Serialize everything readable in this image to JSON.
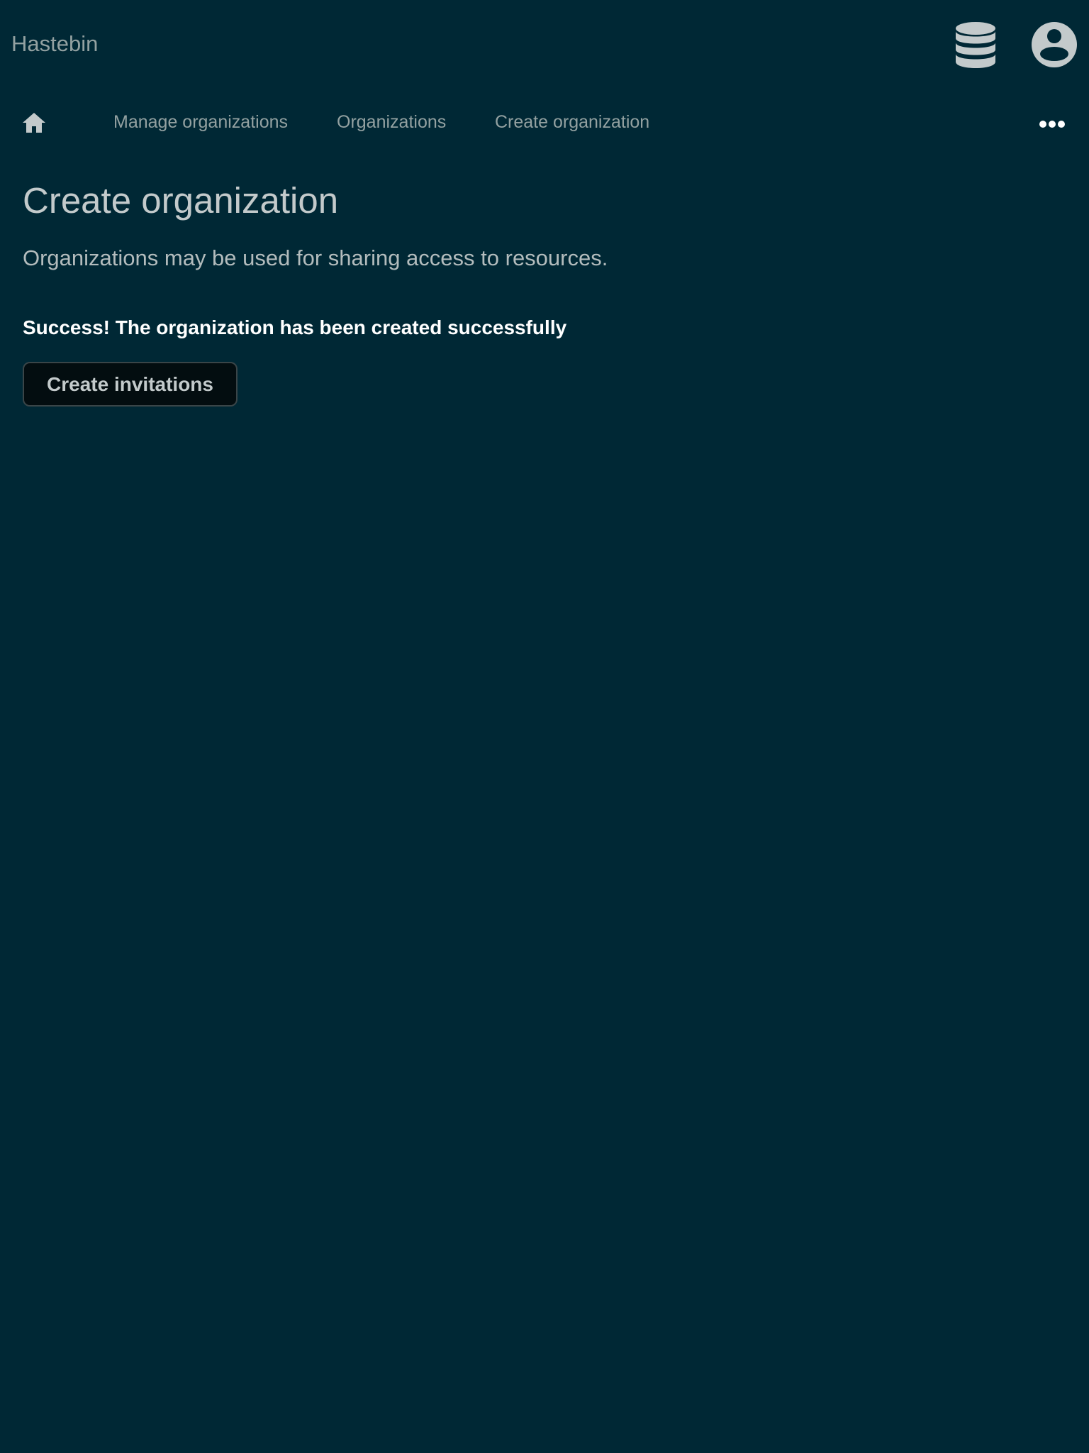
{
  "header": {
    "brand": "Hastebin",
    "database_icon": "database-icon",
    "account_icon": "user-circle-icon"
  },
  "nav": {
    "home_icon": "home-icon",
    "links": [
      {
        "label": "Manage organizations"
      },
      {
        "label": "Organizations"
      },
      {
        "label": "Create organization"
      }
    ],
    "more_icon": "ellipsis-icon"
  },
  "main": {
    "title": "Create organization",
    "description": "Organizations may be used for sharing access to resources.",
    "success_message": "Success! The organization has been created successfully",
    "create_invitations_label": "Create invitations"
  },
  "colors": {
    "background": "#002835",
    "muted_text": "#93a1a1",
    "heading_text": "#c3cacb",
    "success_text": "#ffffff",
    "button_background": "#030d10"
  }
}
